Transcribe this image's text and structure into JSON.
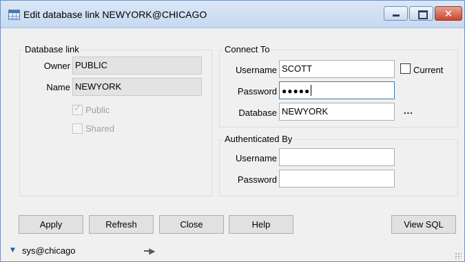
{
  "window": {
    "title": "Edit database link NEWYORK@CHICAGO"
  },
  "database_link": {
    "group_label": "Database link",
    "owner_label": "Owner",
    "owner_value": "PUBLIC",
    "name_label": "Name",
    "name_value": "NEWYORK",
    "public_label": "Public",
    "public_checked": true,
    "shared_label": "Shared",
    "shared_checked": false
  },
  "connect_to": {
    "group_label": "Connect To",
    "username_label": "Username",
    "username_value": "SCOTT",
    "current_label": "Current",
    "current_checked": false,
    "password_label": "Password",
    "password_value": "●●●●●",
    "database_label": "Database",
    "database_value": "NEWYORK",
    "browse_label": "..."
  },
  "authenticated_by": {
    "group_label": "Authenticated By",
    "username_label": "Username",
    "username_value": "",
    "password_label": "Password",
    "password_value": ""
  },
  "buttons": {
    "apply": "Apply",
    "refresh": "Refresh",
    "close": "Close",
    "help": "Help",
    "view_sql": "View SQL"
  },
  "status": {
    "connection": "sys@chicago"
  },
  "icons": {
    "window": "table-icon",
    "status_arrow": "triangle-down-icon",
    "pin": "pin-icon",
    "grip": "resize-grip-icon"
  },
  "colors": {
    "titlebar": "#c6d9f0",
    "close_button": "#c9452c",
    "focus_border": "#3c7fb1"
  }
}
